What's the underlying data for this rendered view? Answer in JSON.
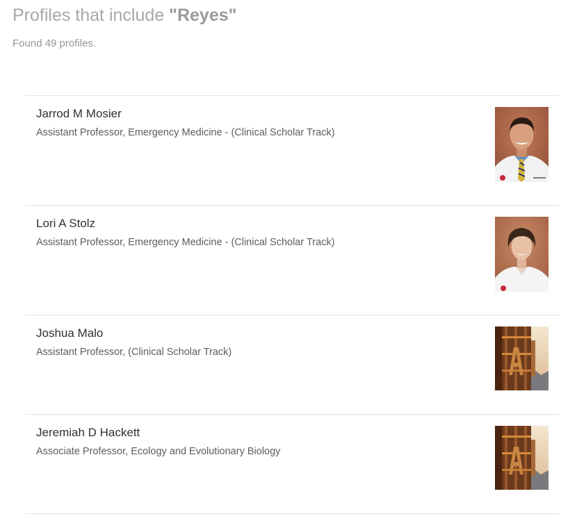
{
  "header": {
    "title_prefix": "Profiles that include ",
    "query": "\"Reyes\"",
    "found_text": "Found 49 profiles."
  },
  "profiles": [
    {
      "name": "Jarrod M Mosier",
      "title": "Assistant Professor, Emergency Medicine - (Clinical Scholar Track)",
      "photo": "portrait-man"
    },
    {
      "name": "Lori A Stolz",
      "title": "Assistant Professor, Emergency Medicine - (Clinical Scholar Track)",
      "photo": "portrait-woman"
    },
    {
      "name": "Joshua Malo",
      "title": "Assistant Professor, (Clinical Scholar Track)",
      "photo": "university-building"
    },
    {
      "name": "Jeremiah D Hackett",
      "title": "Associate Professor, Ecology and Evolutionary Biology",
      "photo": "university-building"
    }
  ]
}
